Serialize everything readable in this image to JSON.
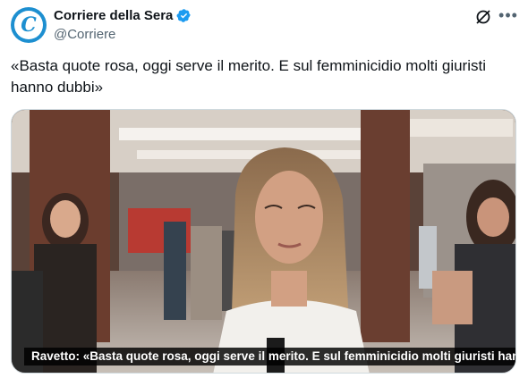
{
  "account": {
    "display_name": "Corriere della Sera",
    "handle": "@Corriere",
    "avatar_letter": "C",
    "brand_color": "#1d8fd0",
    "verified_color": "#1d9bf0"
  },
  "tweet": {
    "text": "«Basta quote rosa, oggi serve il merito. E sul femminicidio molti giuristi hanno dubbi»"
  },
  "media": {
    "caption": "Ravetto: «Basta quote rosa, oggi serve il merito. E sul femminicidio molti giuristi hanno ..."
  },
  "icons": {
    "verified": "verified-badge-icon",
    "grok": "grok-icon",
    "more": "more-options-icon"
  }
}
